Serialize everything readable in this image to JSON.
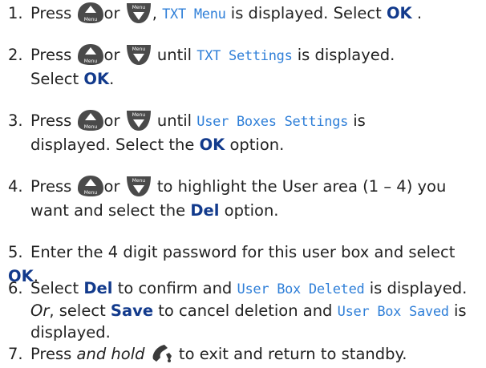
{
  "steps": [
    {
      "num": "1.",
      "t1": "Press",
      "t2": "or",
      "t3": ",",
      "lcd1": "TXT Menu",
      "t4": "is displayed. Select",
      "opt1": "OK",
      "t5": "."
    },
    {
      "num": "2.",
      "t1": "Press",
      "t2": "or",
      "t3": "until",
      "lcd1": "TXT Settings",
      "t4": "is displayed.",
      "t5": "Select",
      "opt1": "OK",
      "t6": "."
    },
    {
      "num": "3.",
      "t1": "Press",
      "t2": "or",
      "t3": "until",
      "lcd1": "User Boxes Settings",
      "t4": "is",
      "t5": "displayed. Select the",
      "opt1": "OK",
      "t6": "option."
    },
    {
      "num": "4.",
      "t1": "Press",
      "t2": "or",
      "t3": "to highlight the User area (1 – 4) you",
      "t4": "want and select the",
      "opt1": "Del",
      "t5": "option."
    },
    {
      "num": "5.",
      "t1": "Enter the 4 digit password for this user box and select",
      "opt1": "OK",
      "t2": "."
    },
    {
      "num": "6.",
      "t1": "Select",
      "opt1": "Del",
      "t2": "to confirm and",
      "lcd1": "User Box Deleted",
      "t3": "is displayed."
    },
    {
      "or_word": "Or",
      "t1": ", select",
      "opt1": "Save",
      "t2": "to cancel deletion and",
      "lcd1": "User Box Saved",
      "t3": "is",
      "t4": "displayed."
    },
    {
      "num": "7.",
      "t1": "Press",
      "em1": "and hold",
      "t2": "to exit and return to standby."
    }
  ],
  "icons": {
    "up_label": "Menu",
    "down_label": "Menu",
    "colors": {
      "button_dark": "#3a3a3a",
      "button_light": "#9a9a9a",
      "lcd_text": "#2f7fd8",
      "option_text": "#123a8c"
    }
  }
}
